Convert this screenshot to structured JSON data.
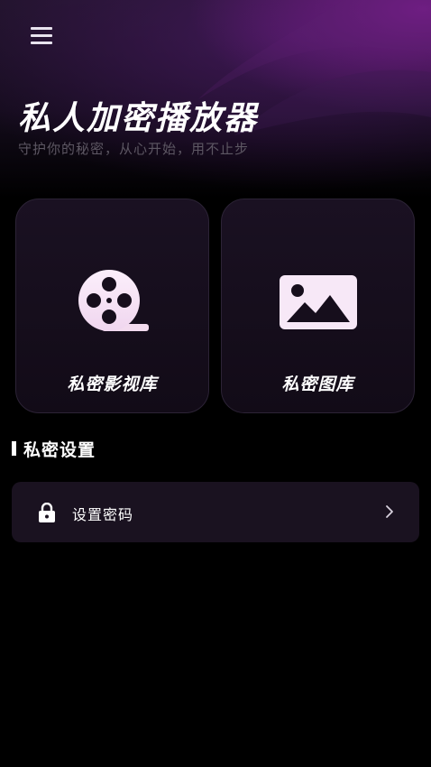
{
  "header": {
    "title": "私人加密播放器",
    "subtitle": "守护你的秘密，从心开始，用不止步"
  },
  "cards": [
    {
      "label": "私密影视库",
      "icon": "film-reel-icon"
    },
    {
      "label": "私密图库",
      "icon": "image-gallery-icon"
    }
  ],
  "settings_section": {
    "title": "私密设置",
    "items": [
      {
        "label": "设置密码",
        "icon": "lock-icon",
        "trailing_icon": "chevron-right-icon"
      }
    ]
  },
  "colors": {
    "background": "#000000",
    "card": "#160e1c",
    "accent_purple": "#5c1c78",
    "icon_fill": "#f5e6f7",
    "subtitle_gray": "#5d5763"
  }
}
